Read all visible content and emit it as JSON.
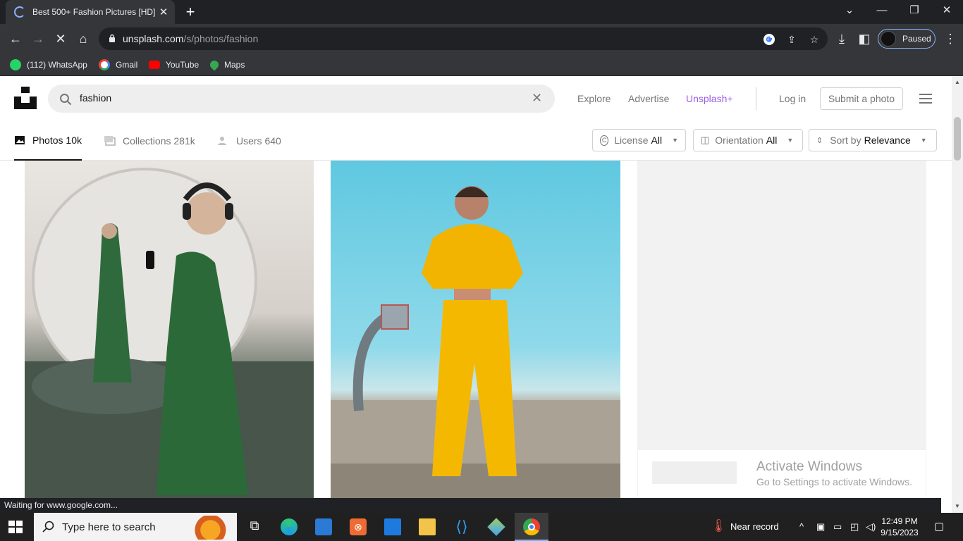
{
  "browser": {
    "tab_title": "Best 500+ Fashion Pictures [HD] |",
    "new_tab": "+",
    "url_domain": "unsplash.com",
    "url_path": "/s/photos/fashion",
    "profile_status": "Paused",
    "bookmarks": [
      "(112) WhatsApp",
      "Gmail",
      "YouTube",
      "Maps"
    ],
    "status_text": "Waiting for www.google.com..."
  },
  "site": {
    "search_value": "fashion",
    "nav": [
      "Explore",
      "Advertise",
      "Unsplash+"
    ],
    "login": "Log in",
    "submit": "Submit a photo",
    "accent_color": "#9b5de5"
  },
  "filters": {
    "tabs": [
      {
        "label": "Photos",
        "count": "10k"
      },
      {
        "label": "Collections",
        "count": "281k"
      },
      {
        "label": "Users",
        "count": "640"
      }
    ],
    "license": {
      "label": "License",
      "value": "All"
    },
    "orientation": {
      "label": "Orientation",
      "value": "All"
    },
    "sort": {
      "label": "Sort by",
      "value": "Relevance"
    }
  },
  "watermark": {
    "line1": "Activate Windows",
    "line2": "Go to Settings to activate Windows."
  },
  "taskbar": {
    "search_placeholder": "Type here to search",
    "weather": "Near record",
    "time": "12:49 PM",
    "date": "9/15/2023"
  }
}
